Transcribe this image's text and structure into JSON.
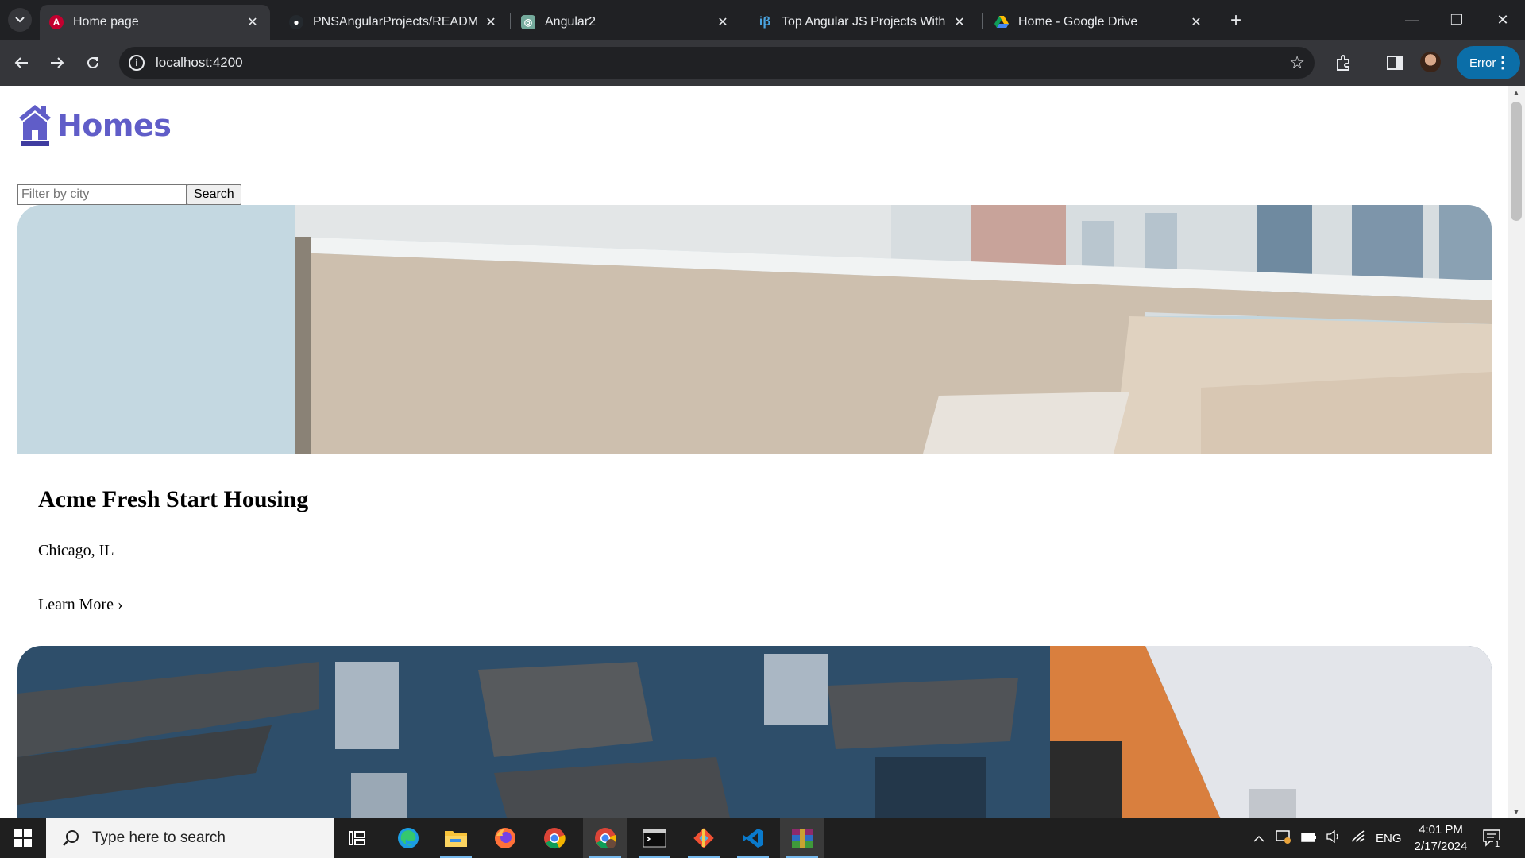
{
  "browser": {
    "tabs": [
      {
        "title": "Home page",
        "active": true,
        "favicon": "angular-icon"
      },
      {
        "title": "PNSAngularProjects/README.m",
        "active": false,
        "favicon": "github-icon"
      },
      {
        "title": "Angular2",
        "active": false,
        "favicon": "openai-icon"
      },
      {
        "title": "Top Angular JS Projects With Sc",
        "active": false,
        "favicon": "interviewbit-icon"
      },
      {
        "title": "Home - Google Drive",
        "active": false,
        "favicon": "google-drive-icon"
      }
    ],
    "url": "localhost:4200",
    "profile_status": "Error"
  },
  "page": {
    "brand": "Homes",
    "filter_placeholder": "Filter by city",
    "search_label": "Search",
    "listings": [
      {
        "name": "Acme Fresh Start Housing",
        "location": "Chicago, IL",
        "link": "Learn More ›"
      },
      {
        "name": "",
        "location": "",
        "link": ""
      }
    ]
  },
  "taskbar": {
    "search_placeholder": "Type here to search",
    "language": "ENG",
    "time": "4:01 PM",
    "date": "2/17/2024",
    "notification_count": "1",
    "apps": [
      "task-view-icon",
      "edge-icon",
      "file-explorer-icon",
      "firefox-icon",
      "chrome-icon",
      "chrome-profile-icon",
      "terminal-icon",
      "git-icon",
      "vscode-icon",
      "winrar-icon"
    ]
  },
  "colors": {
    "brand": "#605dc8",
    "chrome_bg": "#202124",
    "toolbar_bg": "#35363a",
    "error_chip": "#0b6ea8"
  }
}
